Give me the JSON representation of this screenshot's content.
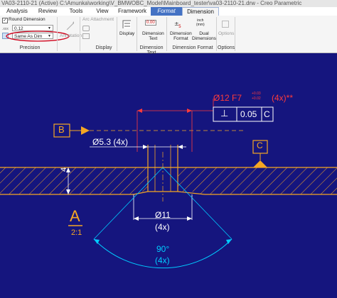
{
  "window_title": "VA03-2110-21 (Active) C:\\Amunka\\working\\V_BMWOBC_Model\\Mainboard_tester\\va03-2110-21.drw - Creo Parametric",
  "tabs": [
    "Analysis",
    "Review",
    "Tools",
    "View",
    "Framework",
    "Format",
    "Dimension"
  ],
  "active_tab": "Dimension",
  "ribbon": {
    "precision": {
      "round_dimension_label": "Round Dimension",
      "round_dimension_checked": true,
      "decimals_value": "0.12",
      "tolerance_value": "Same As Dim",
      "group_label": "Precision"
    },
    "annotation_label": "Annotation",
    "arc_attachment_label": "Arc Attachment",
    "display_label": "Display",
    "display_group_label": "Display",
    "dimension_text_label": "Dimension\nText",
    "dimension_text_group_label": "Dimension Text",
    "dimension_format_label": "Dimension\nFormat",
    "dual_dimensions_label": "Dual\nDimensions",
    "dimension_format_group_label": "Dimension Format",
    "options_label": "Options",
    "options_group_label": "Options",
    "icon_text_0_00": "0.00",
    "icon_text_inch": "inch\n(mm)"
  },
  "drawing": {
    "datum_b": "B",
    "datum_c": "C",
    "datum_a": "A",
    "scale": "2:1",
    "hole_callout": "Ø12 F7",
    "hole_tol_upper": "+0.03",
    "hole_tol_lower": "+0.02",
    "hole_count": "(4x)**",
    "fcf_symbol": "⊥",
    "fcf_value": "0.05",
    "fcf_datum": "C",
    "dim_53": "Ø5.3 (4x)",
    "dim_4": "4",
    "dim_11": "Ø11",
    "dim_11_count": "(4x)",
    "angle": "90°",
    "angle_count": "(4x)"
  },
  "colors": {
    "background": "#15157e",
    "geometry": "#f5a623",
    "dimension": "#ffffff",
    "highlight": "#ff3b3b",
    "angle": "#00ccff",
    "ribbon_accent": "#4472c4",
    "annotation_circle": "#d0021b"
  }
}
